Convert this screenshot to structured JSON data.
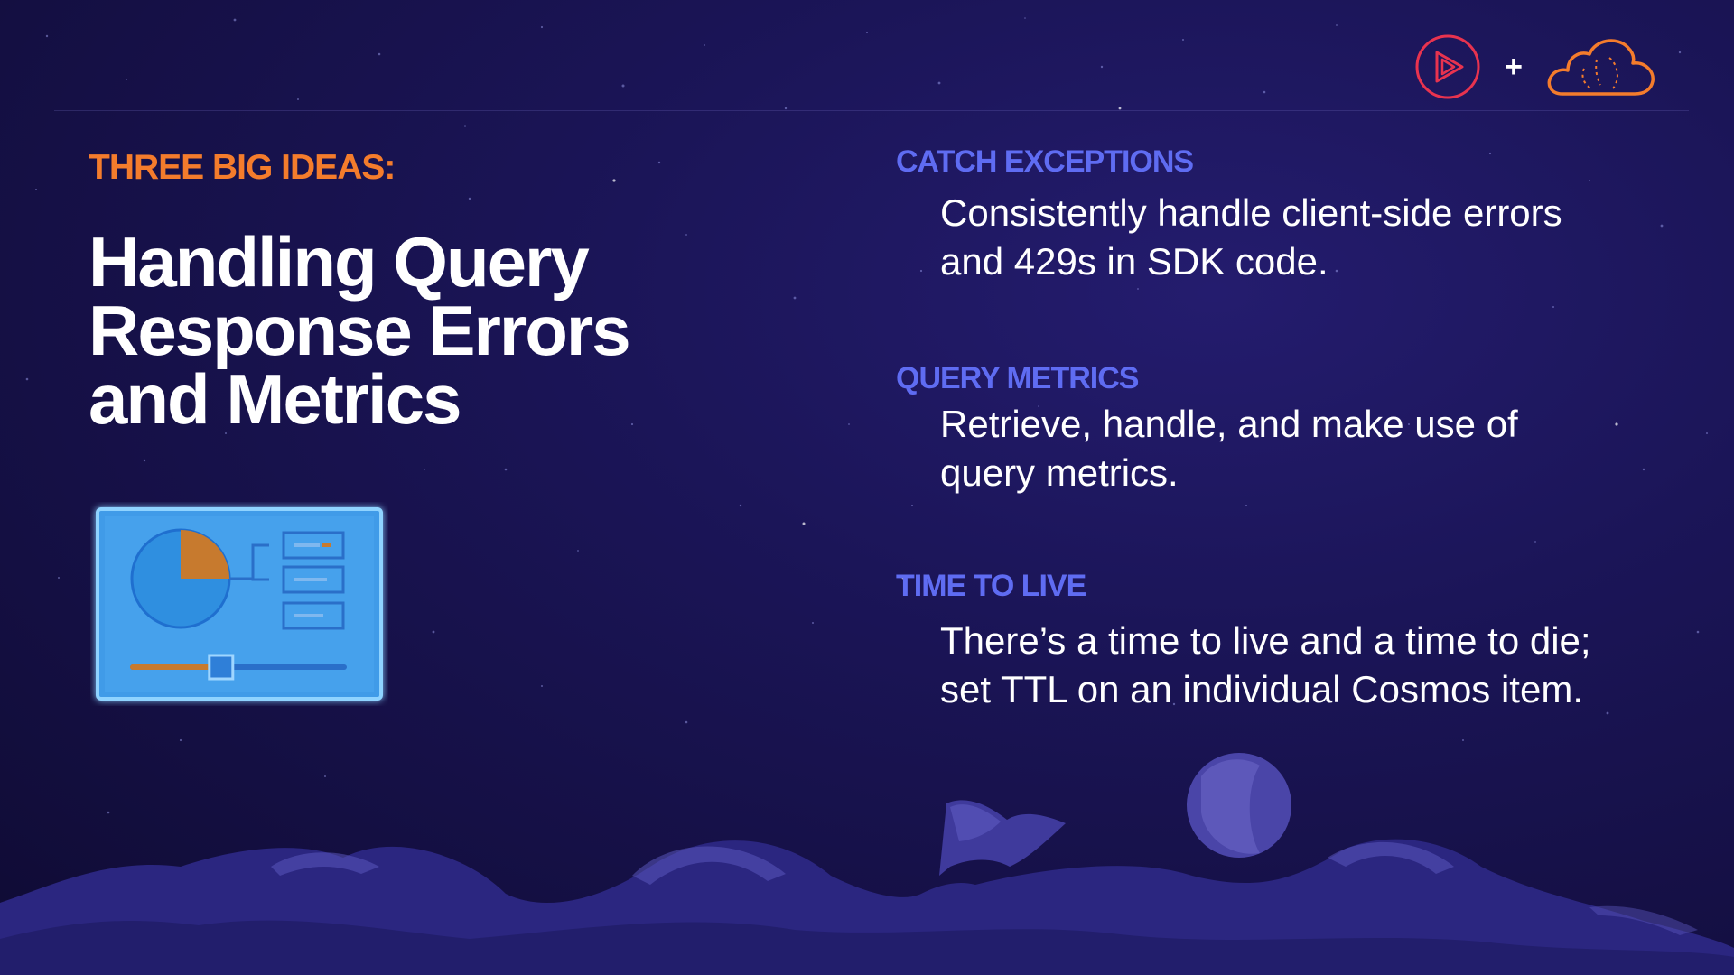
{
  "slide": {
    "eyebrow": "THREE BIG IDEAS:",
    "title_lines": [
      "Handling Query",
      "Response Errors",
      "and Metrics"
    ],
    "colors": {
      "background": "#1b1558",
      "eyebrow": "#f47c2c",
      "heading": "#5f6cf2",
      "body_text": "#ffffff",
      "play_logo": "#e8334f",
      "cloud_logo": "#f47c2c"
    }
  },
  "brand": {
    "plus": "+",
    "icons": [
      "play-logo-icon",
      "cloud-logo-icon"
    ]
  },
  "illustration": {
    "icon": "dashboard-illustration-icon",
    "pie_slice_fraction": 0.25,
    "slider_position_fraction": 0.42
  },
  "ideas": [
    {
      "heading": "CATCH EXCEPTIONS",
      "text_lines": [
        "Consistently handle client-side errors",
        "and 429s in SDK code."
      ]
    },
    {
      "heading": "QUERY METRICS",
      "text_lines": [
        "Retrieve, handle, and make use of",
        "query metrics."
      ]
    },
    {
      "heading": "TIME TO LIVE",
      "text_lines": [
        "There’s a time to live and a time to die;",
        "set TTL on an individual Cosmos item."
      ]
    }
  ]
}
